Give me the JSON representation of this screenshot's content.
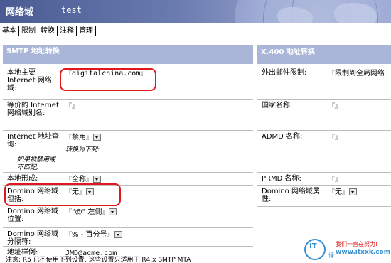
{
  "header": {
    "title": "网络域",
    "subtitle": "test"
  },
  "tabs": [
    {
      "label": "基本"
    },
    {
      "label": "限制"
    },
    {
      "label": "转换"
    },
    {
      "label": "注释"
    },
    {
      "label": "管理"
    }
  ],
  "smtp_panel": {
    "heading": "SMTP 地址转换",
    "rows": {
      "local_primary": {
        "label": "本地主要 Internet 网络域:",
        "value": "digitalchina.com"
      },
      "equivalent": {
        "label": "等价的 Internet 网络域别名:",
        "value": ""
      },
      "address_lookup": {
        "label": "Internet 地址查询:",
        "value": "禁用",
        "sub_label": "转换为下列:",
        "note": "如果被禁用或不匹配,"
      },
      "local_format": {
        "label": "本地形成:",
        "value": "全称"
      },
      "domino_include": {
        "label": "Domino 网络域包括:",
        "value": "无"
      },
      "domino_position": {
        "label": "Domino 网络域位置:",
        "value": "\"@\" 左侧"
      },
      "domino_separator": {
        "label": "Domino 网络域分隔符:",
        "value": "% - 百分号"
      },
      "address_example": {
        "label": "地址样例:",
        "value": "JMD@acme.com"
      }
    },
    "footer": "注意: R5 已不使用下列设置, 这些设置只适用于 R4.x SMTP MTA"
  },
  "x400_panel": {
    "heading": "X.400 地址转换",
    "rows": {
      "outbound_limit": {
        "label": "外出邮件限制:",
        "value": "限制到全局网络"
      },
      "country": {
        "label": "国家名称:",
        "value": ""
      },
      "admd": {
        "label": "ADMD 名称:",
        "value": ""
      },
      "prmd": {
        "label": "PRMD 名称:",
        "value": ""
      },
      "domino_attr": {
        "label": "Domino 网络域属性:",
        "value": "无"
      }
    }
  },
  "watermark": {
    "logo": "IT",
    "ke": "课",
    "line1": "我们一直在努力!",
    "line2": "www.itxxk.com"
  },
  "colors": {
    "header_start": "#4a5b93",
    "panel_header": "#a9b6d8",
    "highlight": "#e0181b"
  }
}
